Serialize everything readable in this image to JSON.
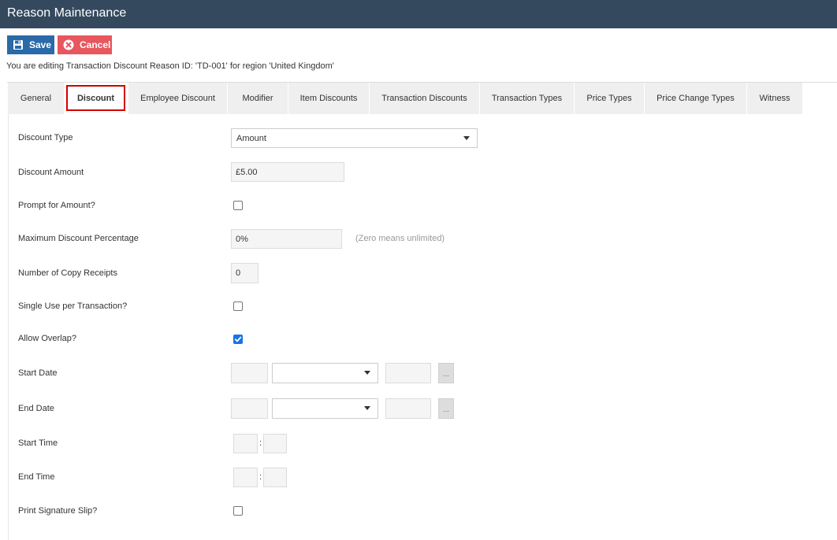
{
  "window": {
    "title": "Reason Maintenance"
  },
  "toolbar": {
    "save_label": "Save",
    "cancel_label": "Cancel"
  },
  "edit_info": "You are editing Transaction Discount Reason ID: 'TD-001' for region 'United Kingdom'",
  "tabs": [
    {
      "label": "General"
    },
    {
      "label": "Discount"
    },
    {
      "label": "Employee Discount"
    },
    {
      "label": "Modifier"
    },
    {
      "label": "Item Discounts"
    },
    {
      "label": "Transaction Discounts"
    },
    {
      "label": "Transaction Types"
    },
    {
      "label": "Price Types"
    },
    {
      "label": "Price Change Types"
    },
    {
      "label": "Witness"
    }
  ],
  "form": {
    "discount_type": {
      "label": "Discount Type",
      "value": "Amount"
    },
    "discount_amount": {
      "label": "Discount Amount",
      "value": "£5.00"
    },
    "prompt_for_amount": {
      "label": "Prompt for Amount?",
      "checked": false
    },
    "max_discount_pct": {
      "label": "Maximum Discount Percentage",
      "value": "0%",
      "hint": "(Zero means unlimited)"
    },
    "copy_receipts": {
      "label": "Number of Copy Receipts",
      "value": "0"
    },
    "single_use": {
      "label": "Single Use per Transaction?",
      "checked": false
    },
    "allow_overlap": {
      "label": "Allow Overlap?",
      "checked": true
    },
    "start_date": {
      "label": "Start Date",
      "picker_label": "..."
    },
    "end_date": {
      "label": "End Date",
      "picker_label": "..."
    },
    "start_time": {
      "label": "Start Time",
      "separator": ":"
    },
    "end_time": {
      "label": "End Time",
      "separator": ":"
    },
    "print_signature_slip": {
      "label": "Print Signature Slip?",
      "checked": false
    }
  }
}
